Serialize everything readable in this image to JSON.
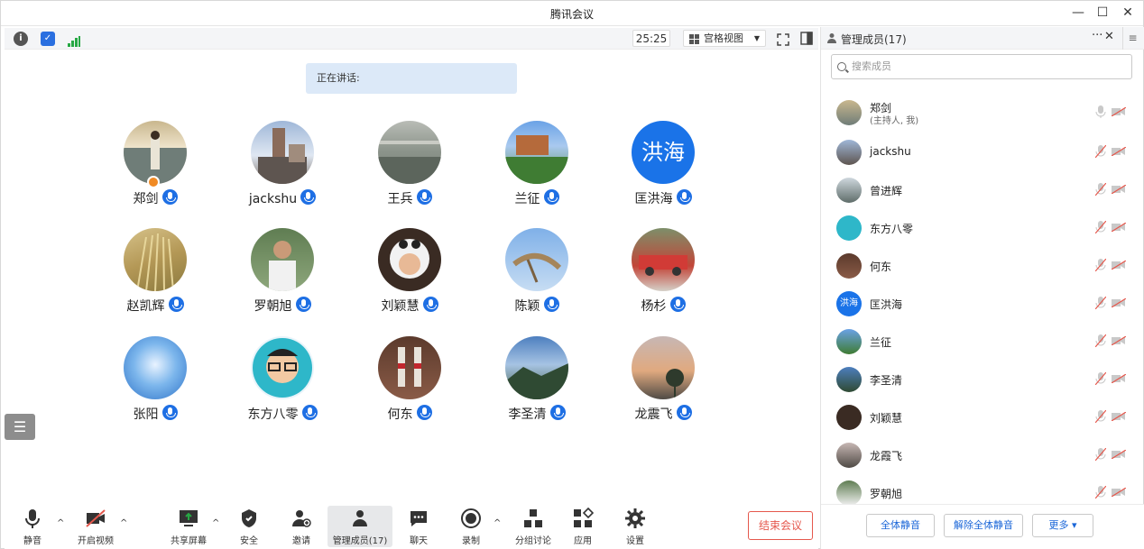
{
  "window": {
    "title": "腾讯会议"
  },
  "topbar": {
    "timer": "25:25",
    "view_label": "宫格视图"
  },
  "speaking": {
    "label": "正在讲话:"
  },
  "grid": [
    {
      "name": "郑剑",
      "host": true
    },
    {
      "name": "jackshu"
    },
    {
      "name": "王兵"
    },
    {
      "name": "兰征"
    },
    {
      "name": "匡洪海",
      "avatar_text": "洪海"
    },
    {
      "name": "赵凯辉"
    },
    {
      "name": "罗朝旭"
    },
    {
      "name": "刘颖慧"
    },
    {
      "name": "陈颖"
    },
    {
      "name": "杨杉"
    },
    {
      "name": "张阳"
    },
    {
      "name": "东方八零"
    },
    {
      "name": "何东"
    },
    {
      "name": "李圣清"
    },
    {
      "name": "龙震飞"
    }
  ],
  "toolbar": {
    "mute": "静音",
    "video": "开启视频",
    "share": "共享屏幕",
    "security": "安全",
    "invite": "邀请",
    "members": "管理成员(17)",
    "chat": "聊天",
    "record": "录制",
    "breakout": "分组讨论",
    "apps": "应用",
    "settings": "设置",
    "end": "结束会议"
  },
  "panel": {
    "title": "管理成员(17)",
    "search_placeholder": "搜索成员",
    "members": [
      {
        "name": "郑剑",
        "sub": "(主持人, 我)"
      },
      {
        "name": "jackshu"
      },
      {
        "name": "曾进辉"
      },
      {
        "name": "东方八零"
      },
      {
        "name": "何东"
      },
      {
        "name": "匡洪海",
        "avatar_text": "洪海"
      },
      {
        "name": "兰征"
      },
      {
        "name": "李圣清"
      },
      {
        "name": "刘颖慧"
      },
      {
        "name": "龙霞飞"
      },
      {
        "name": "罗朝旭"
      }
    ],
    "mute_all": "全体静音",
    "unmute_all": "解除全体静音",
    "more": "更多 ▾"
  },
  "colors": {
    "accent": "#1a73e8",
    "end": "#e5584d",
    "banner": "#dce9f8"
  }
}
